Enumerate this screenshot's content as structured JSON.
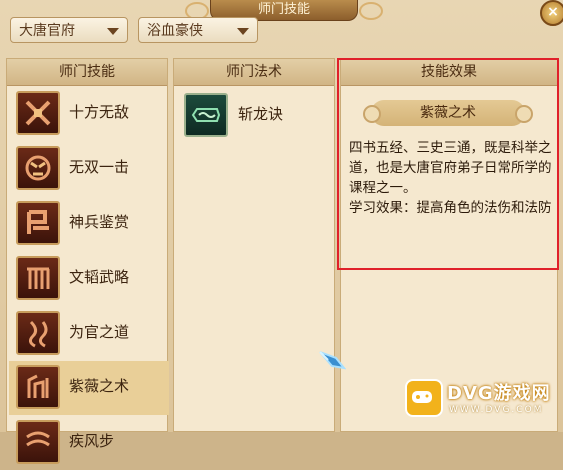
{
  "window": {
    "title": "师门技能",
    "close_label": "×"
  },
  "filters": {
    "sect": "大唐官府",
    "class": "浴血豪侠"
  },
  "skills_panel": {
    "header": "师门技能",
    "items": [
      {
        "name": "十方无敌",
        "icon": "crossed-blades-icon"
      },
      {
        "name": "无双一击",
        "icon": "beast-face-icon"
      },
      {
        "name": "神兵鉴赏",
        "icon": "weapon-rack-icon"
      },
      {
        "name": "文韬武略",
        "icon": "gate-icon"
      },
      {
        "name": "为官之道",
        "icon": "scroll-icon"
      },
      {
        "name": "紫薇之术",
        "icon": "rune-icon",
        "selected": true
      },
      {
        "name": "疾风步",
        "icon": "wind-step-icon"
      }
    ]
  },
  "magic_panel": {
    "header": "师门法术",
    "items": [
      {
        "name": "斩龙诀",
        "icon": "dragon-slash-icon"
      }
    ]
  },
  "effect_panel": {
    "header": "技能效果",
    "title": "紫薇之术",
    "description": "四书五经、三史三通，既是科举之道，也是大唐官府弟子日常所学的课程之一。",
    "effect_line": "学习效果：提高角色的法伤和法防"
  },
  "watermark": {
    "brand": "DVG游戏网",
    "url": "WWW.DVG.COM"
  },
  "colors": {
    "highlight": "#e0202a",
    "panel_bg": "#f5e8cf",
    "selected_row": "#e9cf98"
  }
}
